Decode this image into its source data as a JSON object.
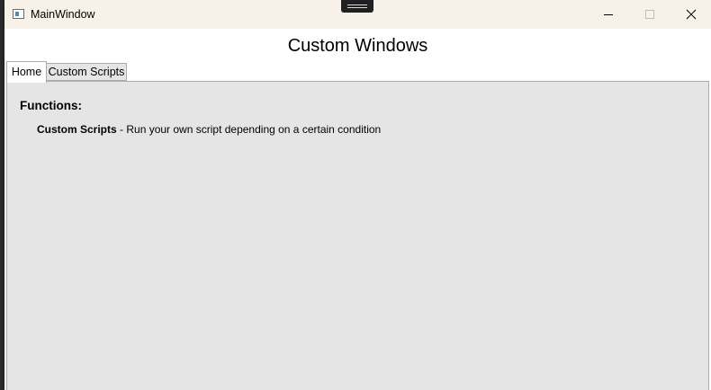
{
  "window": {
    "title": "MainWindow",
    "caption_buttons": {
      "minimize_icon": "minimize-icon",
      "maximize_icon": "maximize-icon",
      "close_icon": "close-icon"
    }
  },
  "header": {
    "title": "Custom Windows"
  },
  "tabs": [
    {
      "label": "Home",
      "selected": true
    },
    {
      "label": "Custom Scripts",
      "selected": false
    }
  ],
  "home": {
    "heading": "Functions:",
    "functions": [
      {
        "name": "Custom Scripts",
        "separator": " - ",
        "description": "Run your own script depending on a certain condition"
      }
    ]
  },
  "colors": {
    "titlebar_bg": "#f7f1ea",
    "content_bg": "#e5e5e5",
    "tab_border": "#acacac",
    "icon_accent": "#4a8fa6"
  }
}
